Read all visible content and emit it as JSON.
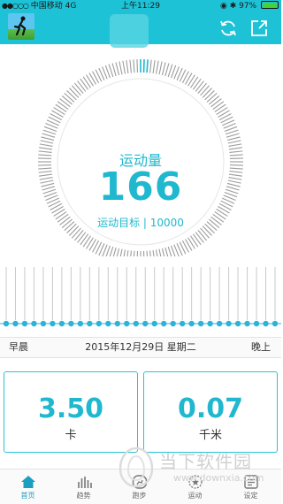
{
  "status_bar": {
    "signal": "●●○○○",
    "carrier": "中国移动",
    "network": "4G",
    "time": "上午11:29",
    "battery": "97%"
  },
  "header": {
    "sync_icon": "refresh-icon",
    "share_icon": "share-icon"
  },
  "gauge": {
    "title": "运动量",
    "value": "166",
    "goal_text": "运动目标 | 10000",
    "progress": 0.0166,
    "accent": "#1fb8cf"
  },
  "timeline": {
    "bar_count": 30,
    "left_label": "早晨",
    "date": "2015年12月29日 星期二",
    "right_label": "晚上"
  },
  "cards": [
    {
      "value": "3.50",
      "unit": "卡"
    },
    {
      "value": "0.07",
      "unit": "千米"
    }
  ],
  "nav": [
    {
      "label": "首页",
      "icon": "home-icon"
    },
    {
      "label": "趋势",
      "icon": "bar-chart-icon"
    },
    {
      "label": "跑步",
      "icon": "running-icon"
    },
    {
      "label": "运动",
      "icon": "activity-icon"
    },
    {
      "label": "设定",
      "icon": "settings-icon"
    }
  ],
  "watermark": {
    "text": "当下软件园",
    "url": "www.downxia.com"
  }
}
